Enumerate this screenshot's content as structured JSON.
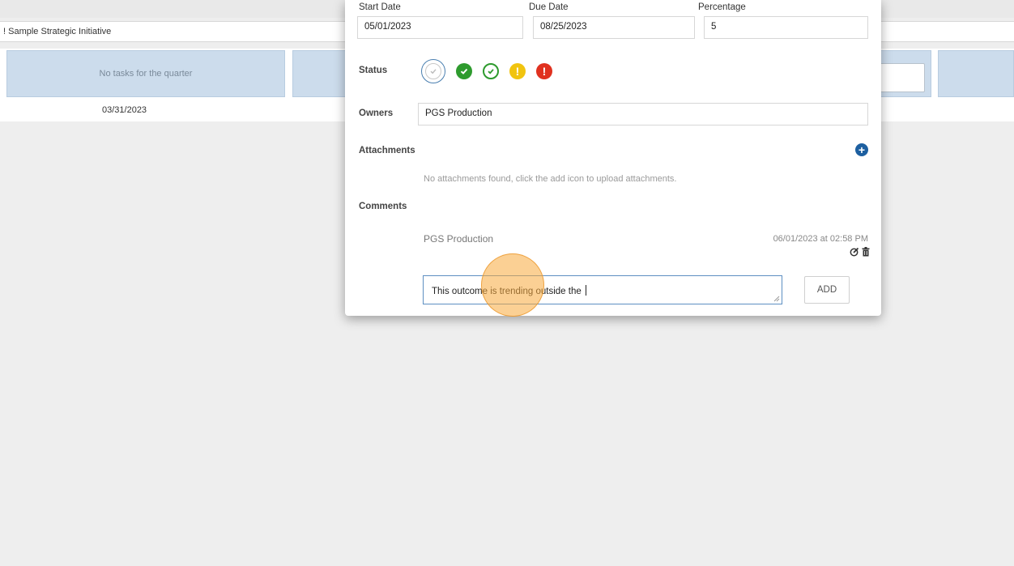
{
  "background": {
    "initiative_title": "Sample Strategic Initiative",
    "initiative_prefix": "!",
    "quarter_empty_text": "No tasks for the quarter",
    "quarter_date": "03/31/2023"
  },
  "modal": {
    "start_date": {
      "label": "Start Date",
      "value": "05/01/2023"
    },
    "due_date": {
      "label": "Due Date",
      "value": "08/25/2023"
    },
    "percentage": {
      "label": "Percentage",
      "value": "5"
    },
    "status": {
      "label": "Status",
      "options": [
        "none-selected",
        "complete",
        "on-track",
        "at-risk",
        "off-track"
      ],
      "selected": "none-selected"
    },
    "owners": {
      "label": "Owners",
      "value": "PGS Production"
    },
    "attachments": {
      "label": "Attachments",
      "empty_text": "No attachments found, click the add icon to upload attachments."
    },
    "comments": {
      "label": "Comments",
      "items": [
        {
          "author": "PGS Production",
          "timestamp": "06/01/2023 at 02:58 PM"
        }
      ],
      "draft": "This outcome is trending outside the ",
      "add_label": "ADD"
    }
  },
  "colors": {
    "accent_blue": "#1d5fa0",
    "status_green": "#2e9b2e",
    "status_yellow": "#f1c40f",
    "status_red": "#e0311f",
    "quarter_fill": "#ccdcec"
  }
}
